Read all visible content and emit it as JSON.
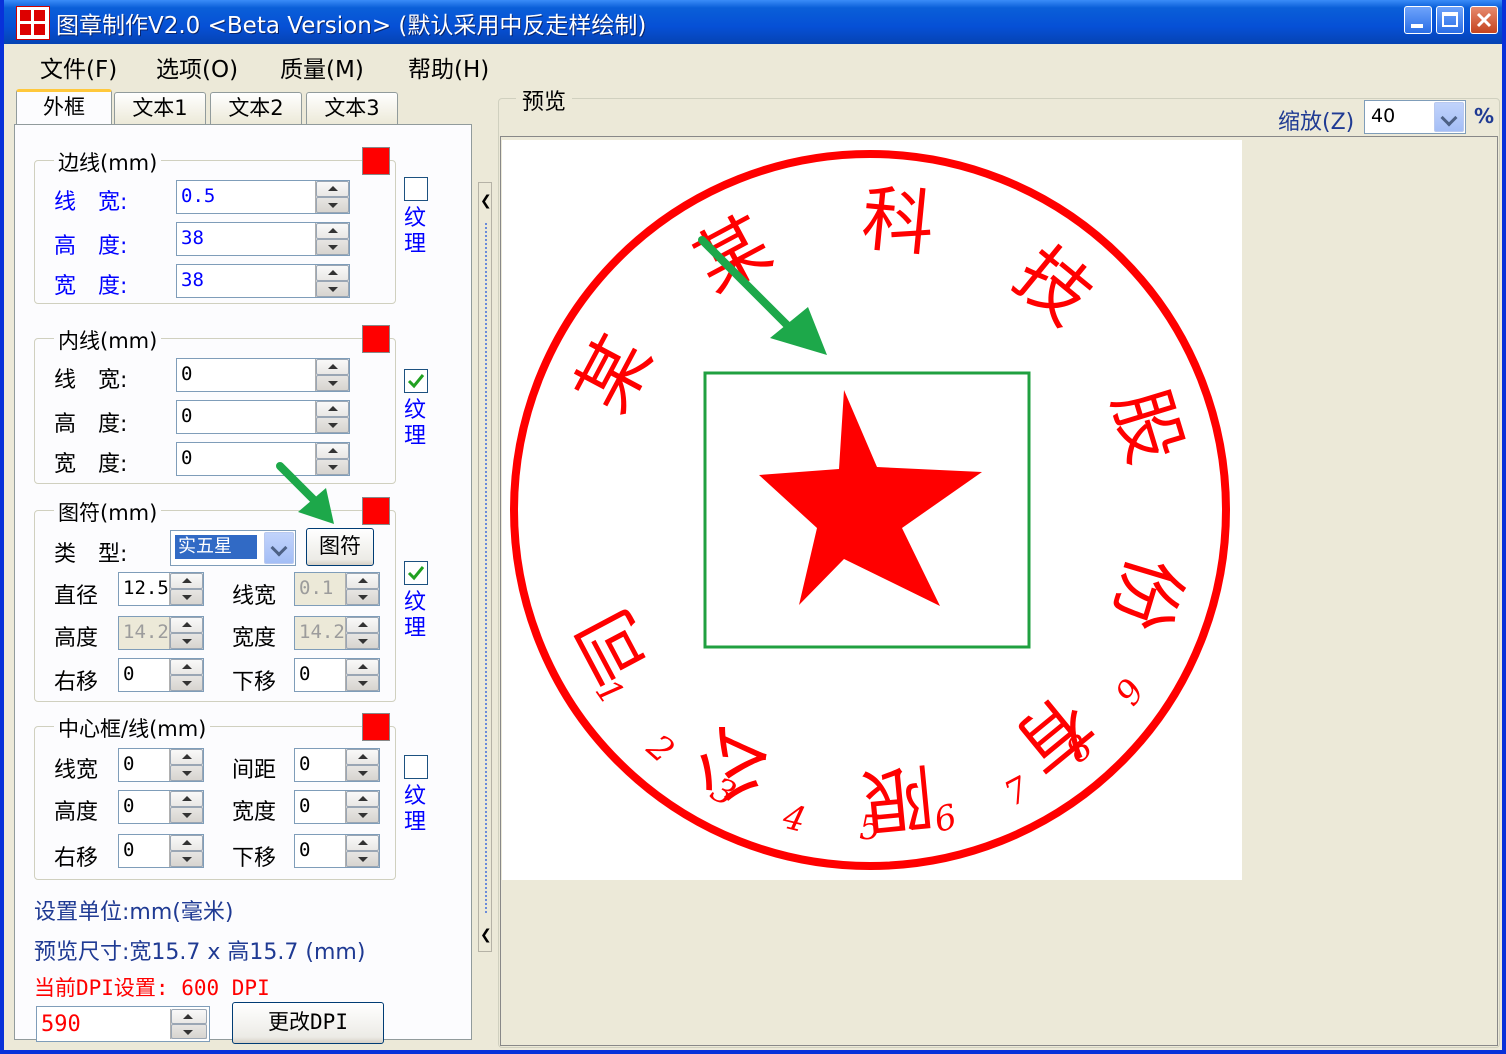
{
  "window": {
    "title": "图章制作V2.0 <Beta Version> (默认采用中反走样绘制)"
  },
  "menu": [
    {
      "label": "文件(F)"
    },
    {
      "label": "选项(O)"
    },
    {
      "label": "质量(M)"
    },
    {
      "label": "帮助(H)"
    }
  ],
  "tabs": [
    {
      "label": "外框",
      "active": true
    },
    {
      "label": "文本1"
    },
    {
      "label": "文本2"
    },
    {
      "label": "文本3"
    }
  ],
  "border_group": {
    "title": "边线(mm)",
    "color": "#ff0000",
    "texture_checked": false,
    "texture_label": "纹理",
    "line_width_label": "线　宽:",
    "line_width": "0.5",
    "height_label": "高　度:",
    "height": "38",
    "width_label": "宽　度:",
    "width": "38"
  },
  "inner_group": {
    "title": "内线(mm)",
    "color": "#ff0000",
    "texture_checked": true,
    "texture_label": "纹理",
    "line_width_label": "线　宽:",
    "line_width": "0",
    "height_label": "高　度:",
    "height": "0",
    "width_label": "宽　度:",
    "width": "0"
  },
  "symbol_group": {
    "title": "图符(mm)",
    "color": "#ff0000",
    "texture_checked": true,
    "texture_label": "纹理",
    "type_label": "类　型:",
    "type_value": "实五星",
    "symbol_button": "图符",
    "diameter_label": "直径",
    "diameter": "12.5",
    "line_width_label": "线宽",
    "line_width": "0.1",
    "height_label": "高度",
    "height": "14.2",
    "width_label": "宽度",
    "width": "14.2",
    "shift_right_label": "右移",
    "shift_right": "0",
    "shift_down_label": "下移",
    "shift_down": "0"
  },
  "center_group": {
    "title": "中心框/线(mm)",
    "color": "#ff0000",
    "texture_checked": false,
    "texture_label": "纹理",
    "line_width_label": "线宽",
    "line_width": "0",
    "spacing_label": "间距",
    "spacing": "0",
    "height_label": "高度",
    "height": "0",
    "width_label": "宽度",
    "width": "0",
    "shift_right_label": "右移",
    "shift_right": "0",
    "shift_down_label": "下移",
    "shift_down": "0"
  },
  "info": {
    "unit": "设置单位:mm(毫米)",
    "preview_size": "预览尺寸:宽15.7 x 高15.7 (mm)",
    "dpi_current": "当前DPI设置: 600 DPI",
    "dpi_value": "590",
    "change_dpi_button": "更改DPI"
  },
  "preview": {
    "title": "预览",
    "zoom_label": "缩放(Z)",
    "zoom_value": "40",
    "zoom_unit": "%"
  },
  "seal": {
    "color": "#ff0000",
    "box_color": "#20a040",
    "chars": [
      "某",
      "某",
      "科",
      "技",
      "股",
      "份",
      "有",
      "限",
      "公",
      "司"
    ],
    "numbers": [
      "1",
      "2",
      "3",
      "4",
      "5",
      "6",
      "7",
      "8",
      "9"
    ]
  }
}
